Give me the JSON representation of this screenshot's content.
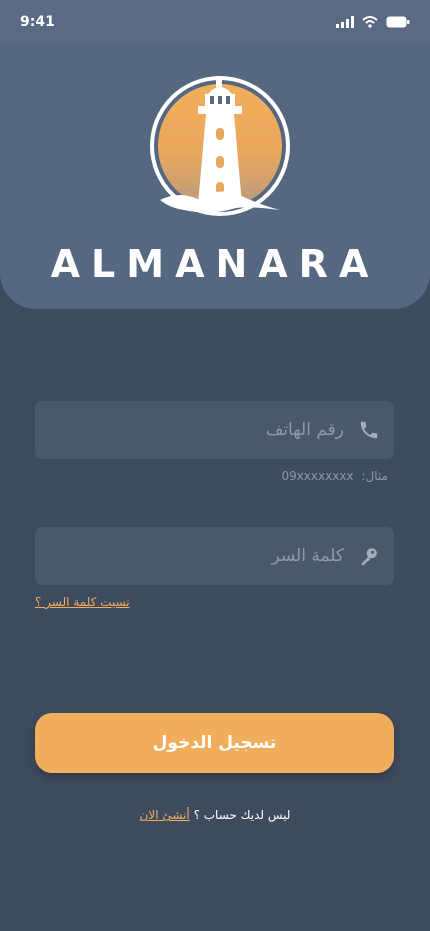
{
  "status_bar": {
    "time": "9:41"
  },
  "brand": {
    "name": "ALMANARA"
  },
  "phone_field": {
    "placeholder": "رقم الهاتف",
    "hint_label": "مثال:",
    "hint_example": "09xxxxxxxx"
  },
  "password_field": {
    "placeholder": "كلمة السر"
  },
  "forgot_password": {
    "label": "نسيت كلمة السر ؟"
  },
  "login_button": {
    "label": "تسجيل الدخول"
  },
  "signup": {
    "prompt": "ليس لديك حساب ؟",
    "link_label": "أنشئ الان"
  },
  "colors": {
    "accent": "#f0ad5c",
    "background": "#3e4b5f",
    "header": "#56687f",
    "field": "#4b586c"
  }
}
